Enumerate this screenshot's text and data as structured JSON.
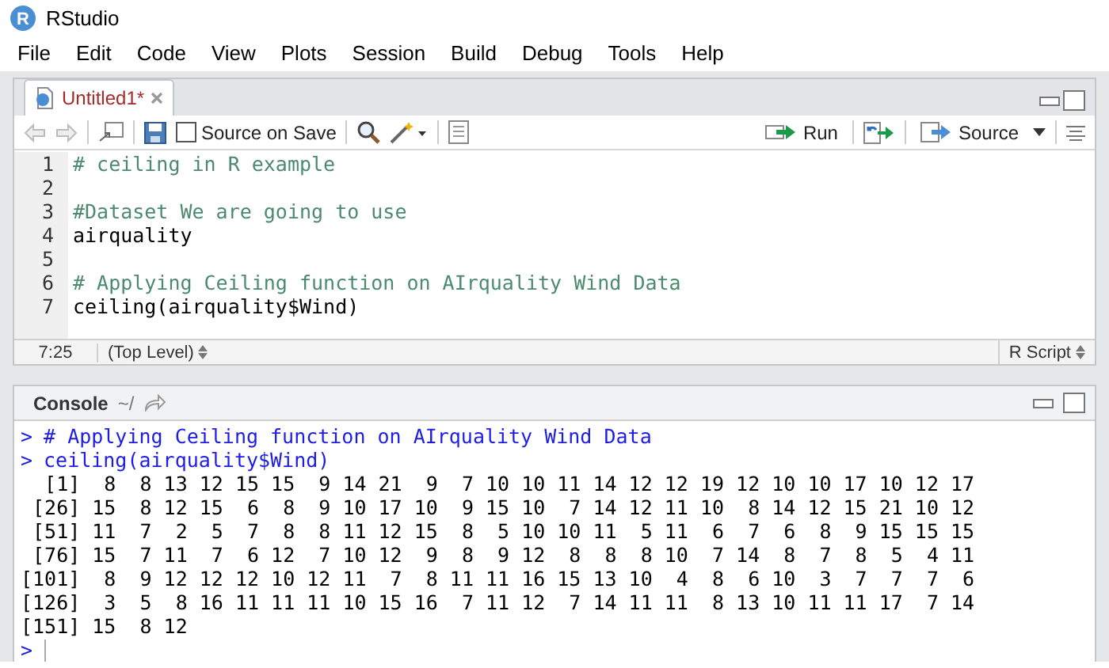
{
  "window": {
    "logo": "R",
    "title": "RStudio"
  },
  "menu": [
    "File",
    "Edit",
    "Code",
    "View",
    "Plots",
    "Session",
    "Build",
    "Debug",
    "Tools",
    "Help"
  ],
  "editor": {
    "tabs": [
      {
        "label": "Untitled1*",
        "selected": true
      }
    ],
    "toolbar": {
      "source_on_save": {
        "label": "Source on Save",
        "checked": false
      },
      "run": "Run",
      "source": "Source"
    },
    "lines": [
      {
        "number": "1",
        "kind": "comment",
        "text": "# ceiling in R example"
      },
      {
        "number": "2",
        "kind": "blank"
      },
      {
        "number": "3",
        "kind": "comment",
        "text": "#Dataset We are going to use"
      },
      {
        "number": "4",
        "kind": "code",
        "text": "airquality"
      },
      {
        "number": "5",
        "kind": "blank"
      },
      {
        "number": "6",
        "kind": "comment",
        "text": "# Applying Ceiling function on AIrquality Wind Data"
      },
      {
        "number": "7",
        "kind": "code",
        "text": "ceiling(airquality$Wind)"
      }
    ],
    "status": {
      "position": "7:25",
      "scope": "(Top Level)",
      "file_type": "R Script"
    }
  },
  "console": {
    "title": "Console",
    "path": "~/",
    "lines": [
      {
        "kind": "input",
        "prompt": ">",
        "text": "# Applying Ceiling function on AIrquality Wind Data"
      },
      {
        "kind": "input",
        "prompt": ">",
        "text": "ceiling(airquality$Wind)"
      },
      {
        "kind": "output",
        "text": "  [1]  8  8 13 12 15 15  9 14 21  9  7 10 10 11 14 12 12 19 12 10 10 17 10 12 17"
      },
      {
        "kind": "output",
        "text": " [26] 15  8 12 15  6  8  9 10 17 10  9 15 10  7 14 12 11 10  8 14 12 15 21 10 12"
      },
      {
        "kind": "output",
        "text": " [51] 11  7  2  5  7  8  8 11 12 15  8  5 10 10 11  5 11  6  7  6  8  9 15 15 15"
      },
      {
        "kind": "output",
        "text": " [76] 15  7 11  7  6 12  7 10 12  9  8  9 12  8  8  8 10  7 14  8  7  8  5  4 11"
      },
      {
        "kind": "output",
        "text": "[101]  8  9 12 12 12 10 12 11  7  8 11 11 16 15 13 10  4  8  6 10  3  7  7  7  6"
      },
      {
        "kind": "output",
        "text": "[126]  3  5  8 16 11 11 11 10 15 16  7 11 12  7 14 11 11  8 13 10 11 11 17  7 14"
      },
      {
        "kind": "output",
        "text": "[151] 15  8 12"
      },
      {
        "kind": "prompt",
        "prompt": ">"
      }
    ]
  }
}
